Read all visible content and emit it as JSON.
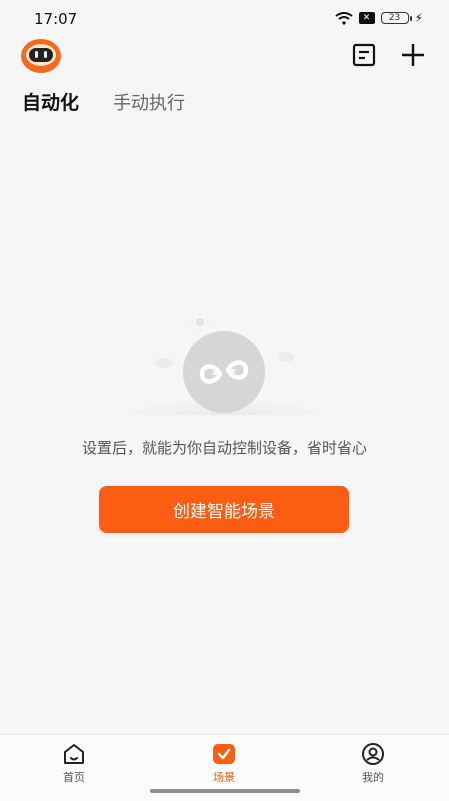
{
  "status_bar": {
    "time": "17:07",
    "battery": "23"
  },
  "header": {
    "avatar_icon": "robot-avatar-icon",
    "list_icon": "list-icon",
    "add_icon": "plus-icon"
  },
  "tabs": [
    {
      "label": "自动化",
      "active": true
    },
    {
      "label": "手动执行",
      "active": false
    }
  ],
  "empty_state": {
    "message": "设置后，就能为你自动控制设备，省时省心",
    "button_label": "创建智能场景",
    "icon": "loop-icon"
  },
  "bottom_nav": [
    {
      "label": "首页",
      "icon": "home-icon",
      "active": false
    },
    {
      "label": "场景",
      "icon": "scene-check-icon",
      "active": true
    },
    {
      "label": "我的",
      "icon": "profile-icon",
      "active": false
    }
  ],
  "colors": {
    "accent": "#fb5d12",
    "background": "#f6f6f6"
  }
}
